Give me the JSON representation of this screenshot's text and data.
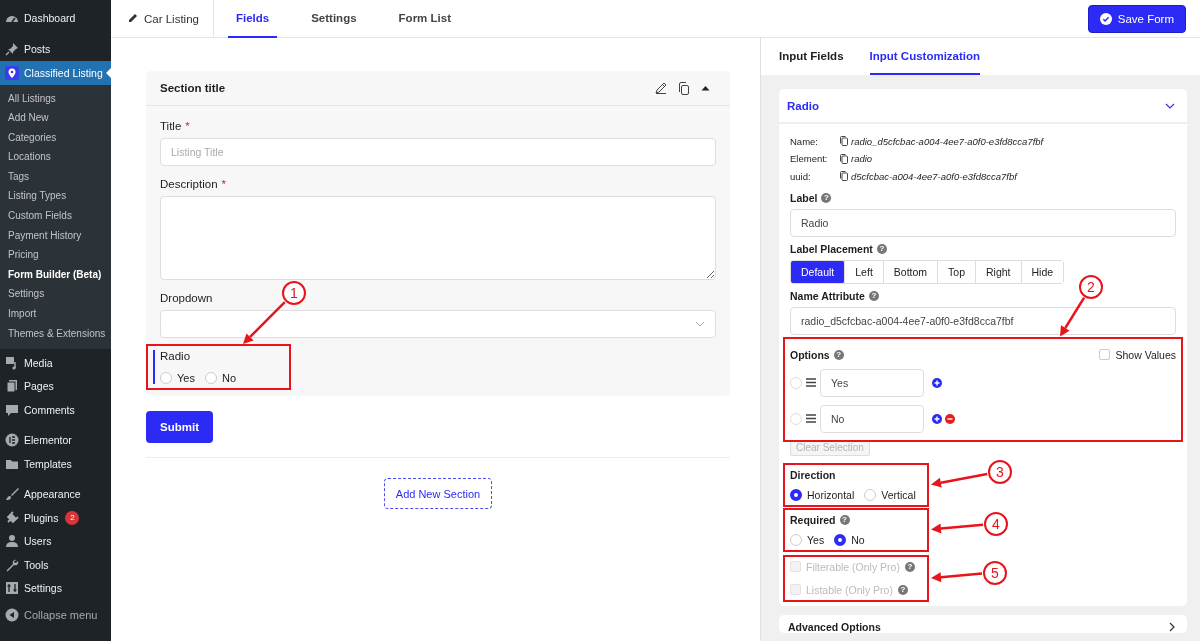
{
  "sidebar": {
    "groups": [
      {
        "items": [
          {
            "label": "Dashboard",
            "selected": false
          }
        ]
      },
      {
        "items": [
          {
            "label": "Posts",
            "selected": false
          },
          {
            "label": "Classified Listing",
            "selected": true,
            "children": [
              {
                "label": "All Listings",
                "selected": false
              },
              {
                "label": "Add New",
                "selected": false
              },
              {
                "label": "Categories",
                "selected": false
              },
              {
                "label": "Locations",
                "selected": false
              },
              {
                "label": "Tags",
                "selected": false
              },
              {
                "label": "Listing Types",
                "selected": false
              },
              {
                "label": "Custom Fields",
                "selected": false
              },
              {
                "label": "Payment History",
                "selected": false
              },
              {
                "label": "Pricing",
                "selected": false
              },
              {
                "label": "Form Builder (Beta)",
                "selected": true
              },
              {
                "label": "Settings",
                "selected": false
              },
              {
                "label": "Import",
                "selected": false
              },
              {
                "label": "Themes & Extensions",
                "selected": false
              }
            ]
          },
          {
            "label": "Media",
            "selected": false
          },
          {
            "label": "Pages",
            "selected": false
          },
          {
            "label": "Comments",
            "selected": false
          }
        ]
      },
      {
        "items": [
          {
            "label": "Elementor",
            "selected": false
          },
          {
            "label": "Templates",
            "selected": false
          }
        ]
      },
      {
        "items": [
          {
            "label": "Appearance",
            "selected": false
          },
          {
            "label": "Plugins",
            "selected": false,
            "badge": "2"
          },
          {
            "label": "Users",
            "selected": false
          },
          {
            "label": "Tools",
            "selected": false
          },
          {
            "label": "Settings",
            "selected": false
          }
        ]
      }
    ],
    "collapse_label": "Collapse menu"
  },
  "top_bar": {
    "form_name": "Car Listing",
    "tabs": [
      {
        "label": "Fields",
        "selected": true
      },
      {
        "label": "Settings",
        "selected": false
      },
      {
        "label": "Form List",
        "selected": false
      }
    ],
    "save_button": "Save Form"
  },
  "form": {
    "section_title": "Section title",
    "fields": [
      {
        "kind": "text",
        "label": "Title",
        "required_mark": "*",
        "placeholder": "Listing Title"
      },
      {
        "kind": "textarea",
        "label": "Description",
        "required_mark": "*"
      },
      {
        "kind": "select",
        "label": "Dropdown"
      },
      {
        "kind": "radio",
        "label": "Radio",
        "active": true,
        "options": [
          {
            "label": "Yes",
            "selected": false
          },
          {
            "label": "No",
            "selected": false
          }
        ]
      }
    ],
    "submit_button": "Submit",
    "add_section_button": "Add New Section"
  },
  "panel": {
    "tabs": [
      {
        "label": "Input Fields",
        "selected": false
      },
      {
        "label": "Input Customization",
        "selected": true
      }
    ],
    "field_title": "Radio",
    "meta": [
      {
        "label": "Name:",
        "value": "radio_d5cfcbac-a004-4ee7-a0f0-e3fd8cca7fbf"
      },
      {
        "label": "Element:",
        "value": "radio"
      },
      {
        "label": "uuid:",
        "value": "d5cfcbac-a004-4ee7-a0f0-e3fd8cca7fbf"
      }
    ],
    "label_setting": {
      "label": "Label",
      "help": "?",
      "value": "Radio"
    },
    "placement": {
      "label": "Label Placement",
      "help": "?",
      "options": [
        {
          "label": "Default",
          "selected": true
        },
        {
          "label": "Left",
          "selected": false
        },
        {
          "label": "Bottom",
          "selected": false
        },
        {
          "label": "Top",
          "selected": false
        },
        {
          "label": "Right",
          "selected": false
        },
        {
          "label": "Hide",
          "selected": false
        }
      ]
    },
    "name_attribute": {
      "label": "Name Attribute",
      "help": "?",
      "value": "radio_d5cfcbac-a004-4ee7-a0f0-e3fd8cca7fbf"
    },
    "options_setting": {
      "label": "Options",
      "help": "?",
      "show_values": {
        "label": "Show Values",
        "checked": false
      },
      "items": [
        {
          "value": "Yes",
          "selected": false,
          "actions": [
            {
              "kind": "add"
            }
          ]
        },
        {
          "value": "No",
          "selected": false,
          "actions": [
            {
              "kind": "add"
            },
            {
              "kind": "remove"
            }
          ]
        }
      ],
      "clear_button": {
        "label": "Clear Selection",
        "disabled": true
      }
    },
    "direction": {
      "label": "Direction",
      "choices": [
        {
          "label": "Horizontal",
          "selected": true
        },
        {
          "label": "Vertical",
          "selected": false
        }
      ]
    },
    "required": {
      "label": "Required",
      "help": "?",
      "choices": [
        {
          "label": "Yes",
          "selected": false
        },
        {
          "label": "No",
          "selected": true
        }
      ]
    },
    "pro_flags": [
      {
        "label": "Filterable (Only Pro)",
        "help": "?",
        "checked": false,
        "disabled": true
      },
      {
        "label": "Listable (Only Pro)",
        "help": "?",
        "checked": false,
        "disabled": true
      }
    ],
    "advanced_title": "Advanced Options"
  },
  "annotations": [
    {
      "number": "1"
    },
    {
      "number": "2"
    },
    {
      "number": "3"
    },
    {
      "number": "4"
    },
    {
      "number": "5"
    }
  ]
}
